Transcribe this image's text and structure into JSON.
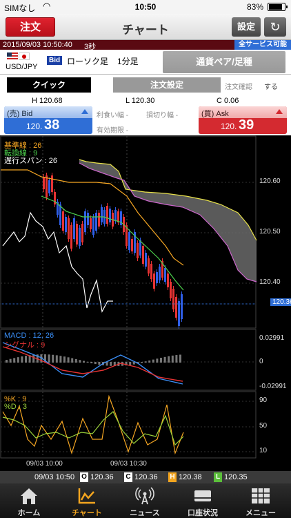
{
  "status": {
    "carrier": "SIMなし",
    "time": "10:50",
    "battery": "83%"
  },
  "nav": {
    "order": "注文",
    "title": "チャート",
    "settings": "設定"
  },
  "info": {
    "timestamp": "2015/09/03 10:50:40",
    "interval": "3秒",
    "service": "全サービス可能"
  },
  "pair": {
    "name": "USD/JPY",
    "side": "Bid",
    "candle": "ローソク足",
    "period": "1分足",
    "button": "通貨ペア/足種"
  },
  "order_bar": {
    "quick": "クイック",
    "settings": "注文設定",
    "confirm_label": "注文確認",
    "confirm_value": "する"
  },
  "hlc": {
    "h": "H  120.68",
    "l": "L  120.30",
    "c": "C  0.06"
  },
  "prices": {
    "bid_label": "(売) Bid",
    "bid_small": "120.",
    "bid_big": "38",
    "ask_label": "(買) Ask",
    "ask_small": "120.",
    "ask_big": "39",
    "profit": "利食い幅 -",
    "loss": "損切り幅 -",
    "expiry": "有効期限 -"
  },
  "chart_data": {
    "type": "candlestick",
    "instrument": "USD/JPY",
    "price_axis": [
      "120.60",
      "120.50",
      "120.40"
    ],
    "price_ylim": [
      120.3,
      120.68
    ],
    "current_price": "120.36",
    "x_ticks": [
      "09/03 10:00",
      "09/03 10:30"
    ],
    "ichimoku_legend": [
      "基準線 : 26",
      "転換線 : 9",
      "遅行スパン : 26"
    ],
    "macd_legend": [
      "MACD : 12, 26",
      "シグナル : 9"
    ],
    "macd_axis": [
      "0.02991",
      "0",
      "-0.02991"
    ],
    "stoch_legend": [
      "%K : 9",
      "%D : 3"
    ],
    "stoch_axis": [
      "90",
      "50",
      "10"
    ],
    "colors": {
      "kijun": "#f5a623",
      "tenkan": "#4ccf4c",
      "chikou": "#ffffff",
      "cloud_upper": "#e8e14a",
      "cloud_lower": "#cc66cc",
      "macd": "#3a8ef6",
      "signal": "#e83333",
      "k": "#f5a623",
      "d": "#9ad13a",
      "up": "#2f5fe8",
      "down": "#e83333"
    }
  },
  "ohlc": {
    "time": "09/03 10:50",
    "o": "O",
    "o_val": "120.36",
    "c": "C",
    "c_val": "120.36",
    "h": "H",
    "h_val": "120.38",
    "l": "L",
    "l_val": "120.35"
  },
  "tabs": [
    "ホーム",
    "チャート",
    "ニュース",
    "口座状況",
    "メニュー"
  ]
}
